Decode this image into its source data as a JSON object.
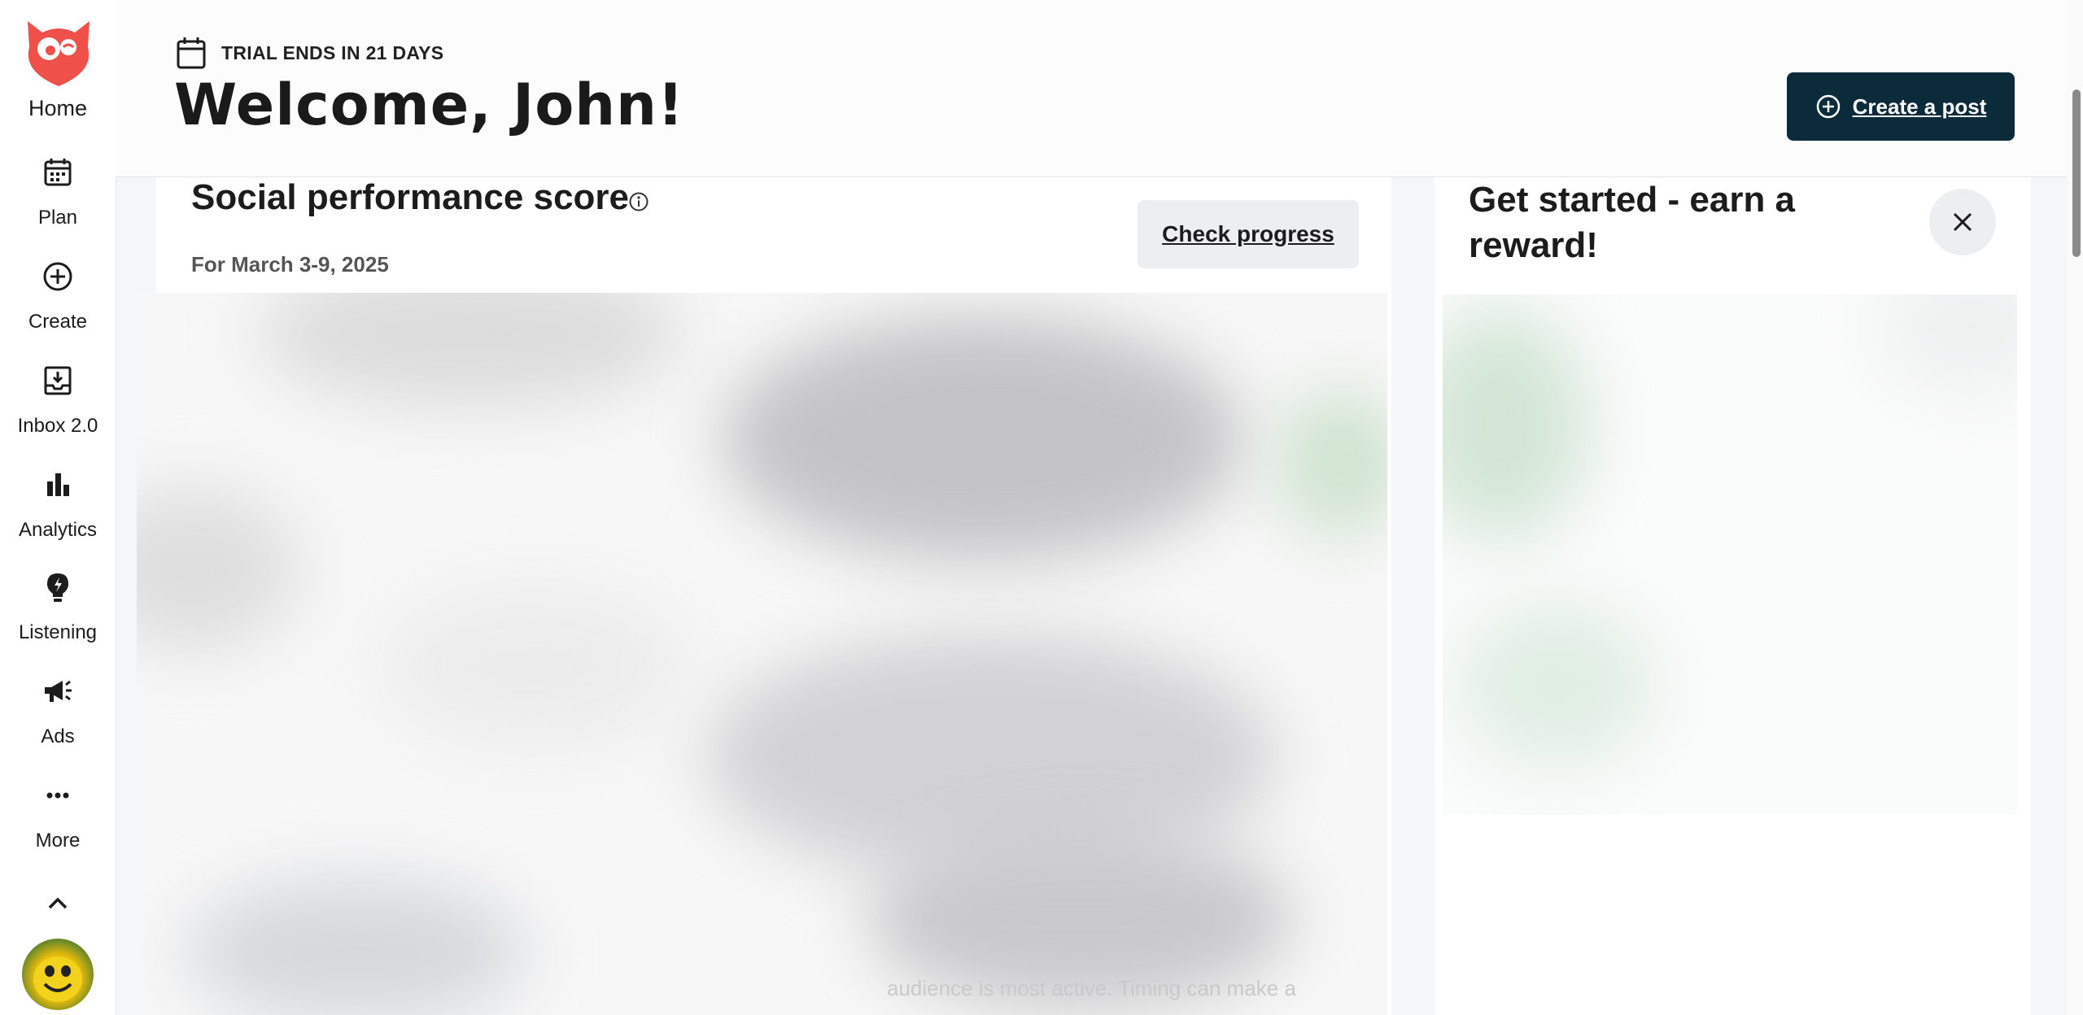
{
  "sidebar": {
    "logo": "owl-logo-icon",
    "items": [
      {
        "label": "Home",
        "icon": "owl-icon"
      },
      {
        "label": "Plan",
        "icon": "calendar-icon"
      },
      {
        "label": "Create",
        "icon": "plus-circle-icon"
      },
      {
        "label": "Inbox 2.0",
        "icon": "inbox-icon"
      },
      {
        "label": "Analytics",
        "icon": "bar-chart-icon"
      },
      {
        "label": "Listening",
        "icon": "lightbulb-icon"
      },
      {
        "label": "Ads",
        "icon": "megaphone-icon"
      },
      {
        "label": "More",
        "icon": "more-dots-icon"
      }
    ],
    "collapse_icon": "chevron-up-icon"
  },
  "header": {
    "trial_text": "TRIAL ENDS IN 21 DAYS",
    "welcome": "Welcome, John!",
    "create_post_label": "Create a post"
  },
  "performance_card": {
    "title": "Social performance score",
    "subtitle": "For March 3-9, 2025",
    "check_label": "Check progress",
    "faded_text": "audience is most active. Timing can make a"
  },
  "reward_card": {
    "title": "Get started - earn a reward!"
  },
  "colors": {
    "accent_dark": "#0b2a3a",
    "brand_red": "#f0504a",
    "button_gray": "#eceef0"
  }
}
